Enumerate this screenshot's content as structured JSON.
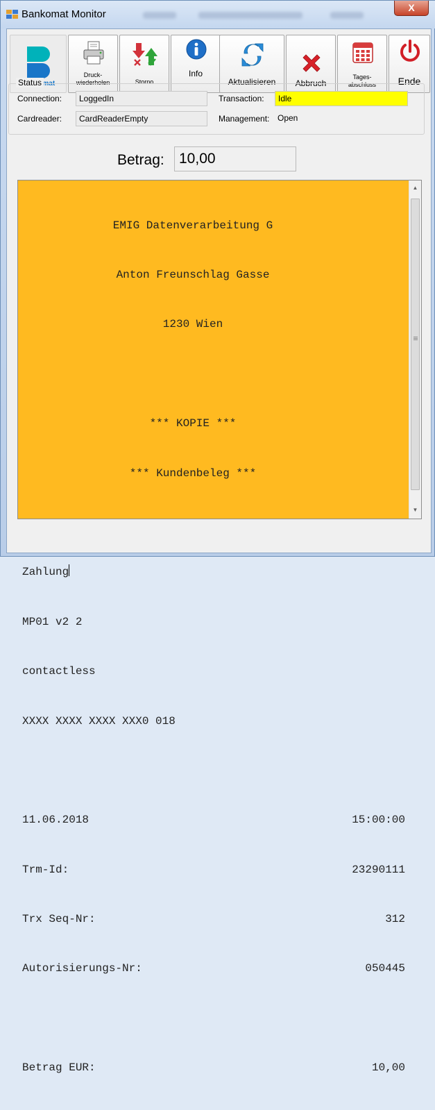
{
  "window": {
    "title": "Bankomat Monitor",
    "close_label": "X"
  },
  "toolbar": {
    "bankomat_label": "Bankomat",
    "druck_label_1": "Druck-",
    "druck_label_2": "wiederholen",
    "storno_label": "Storno",
    "info_label": "Info",
    "aktualisieren_label": "Aktualisieren",
    "abbruch_label": "Abbruch",
    "tages_label_1": "Tages-",
    "tages_label_2": "abschluss",
    "ende_label": "Ende"
  },
  "status": {
    "legend": "Status",
    "connection_label": "Connection:",
    "connection_value": "LoggedIn",
    "cardreader_label": "Cardreader:",
    "cardreader_value": "CardReaderEmpty",
    "transaction_label": "Transaction:",
    "transaction_value": "Idle",
    "management_label": "Management:",
    "management_value": "Open"
  },
  "betrag": {
    "label": "Betrag:",
    "value": "10,00"
  },
  "receipt": {
    "header": [
      "EMIG Datenverarbeitung G",
      "Anton Freunschlag Gasse",
      "1230 Wien"
    ],
    "kopie": "*** KOPIE ***",
    "kundenbeleg": "*** Kundenbeleg ***",
    "zahlung": "Zahlung",
    "lines": [
      "MP01 v2 2",
      "contactless",
      "XXXX XXXX XXXX XXX0 018"
    ],
    "date": "11.06.2018",
    "time": "15:00:00",
    "trm_label": "Trm-Id:",
    "trm_value": "23290111",
    "seq_label": "Trx Seq-Nr:",
    "seq_value": "312",
    "auth_label": "Autorisierungs-Nr:",
    "auth_value": "050445",
    "betrag_label": "Betrag EUR:",
    "betrag_value": "10,00"
  },
  "colors": {
    "receipt_bg": "#ffba20",
    "transaction_highlight": "#ffff00",
    "close_red": "#c7442a"
  }
}
